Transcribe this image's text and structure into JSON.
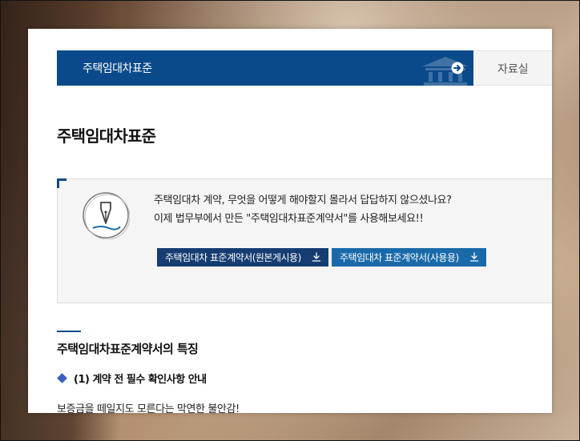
{
  "nav": {
    "primary_label": "주택임대차표준",
    "secondary_label": "자료실"
  },
  "page_title": "주택임대차표준",
  "infobox": {
    "line1": "주택임대차 계약, 무엇을 어떻게 해야할지 몰라서 답답하지 않으셨나요?",
    "line2": "이제 법무부에서 만든 \"주택임대차표준계약서\"를 사용해보세요!!",
    "buttons": [
      {
        "label": "주택임대차 표준계약서(원본게시용)"
      },
      {
        "label": "주택임대차 표준계약서(사용용)"
      }
    ]
  },
  "section": {
    "title": "주택임대차표준계약서의 특징",
    "subtitle": "(1) 계약 전 필수 확인사항 안내",
    "body_text": "보증금을 떼일지도 모른다는 막연한 불안감!"
  },
  "colors": {
    "nav_primary": "#0b4a8a",
    "button_dark": "#163d72",
    "button_light": "#1a6aa9",
    "diamond": "#3a5fbe"
  },
  "icons": [
    "arrow-right-circle-icon",
    "building-icon",
    "fountain-pen-icon",
    "download-icon",
    "diamond-bullet-icon"
  ]
}
